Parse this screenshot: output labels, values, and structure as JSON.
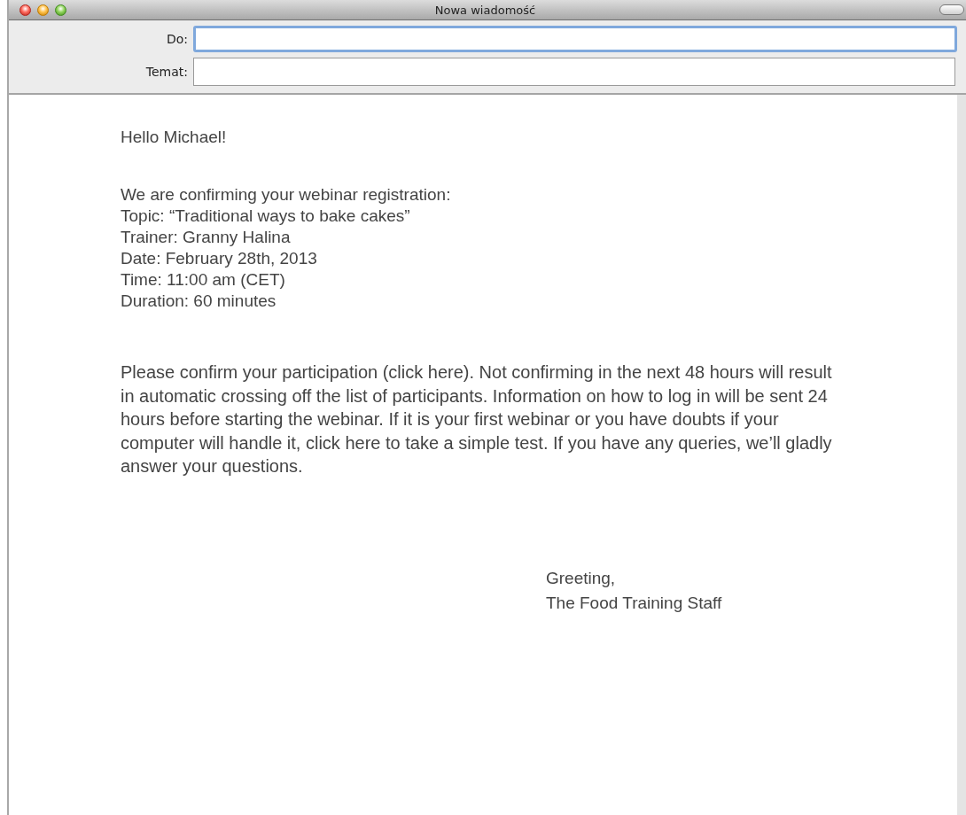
{
  "window": {
    "title": "Nowa wiadomość"
  },
  "fields": [
    {
      "label": "Do:",
      "focused": true
    },
    {
      "label": "Temat:",
      "focused": false
    }
  ],
  "body": {
    "greeting": "Hello Michael!",
    "details": [
      "We are confirming your webinar registration:",
      "Topic: “Traditional ways to bake cakes”",
      "Trainer: Granny Halina",
      "Date: February 28th, 2013",
      "Time: 11:00 am (CET)",
      "Duration: 60 minutes"
    ],
    "paragraph": "Please confirm your participation (click here). Not confirming in the next 48 hours will result in automatic crossing off the list of participants. Information on how to log in will be sent 24 hours before starting the webinar. If it is your first webinar or you have doubts if your computer will handle it, click here to take a simple test. If you have any queries, we’ll gladly answer your questions.",
    "signature": [
      "Greeting,",
      "The Food Training Staff"
    ]
  }
}
